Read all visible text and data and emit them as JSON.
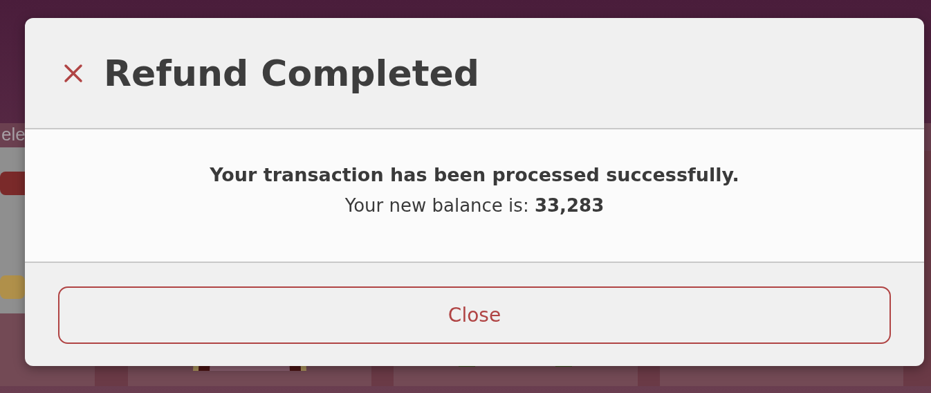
{
  "background": {
    "heading": "ele"
  },
  "dialog": {
    "title": "Refund Completed",
    "message": "Your transaction has been processed successfully.",
    "balance_label": "Your new balance is:",
    "balance": "33,283",
    "close_button": "Close"
  }
}
